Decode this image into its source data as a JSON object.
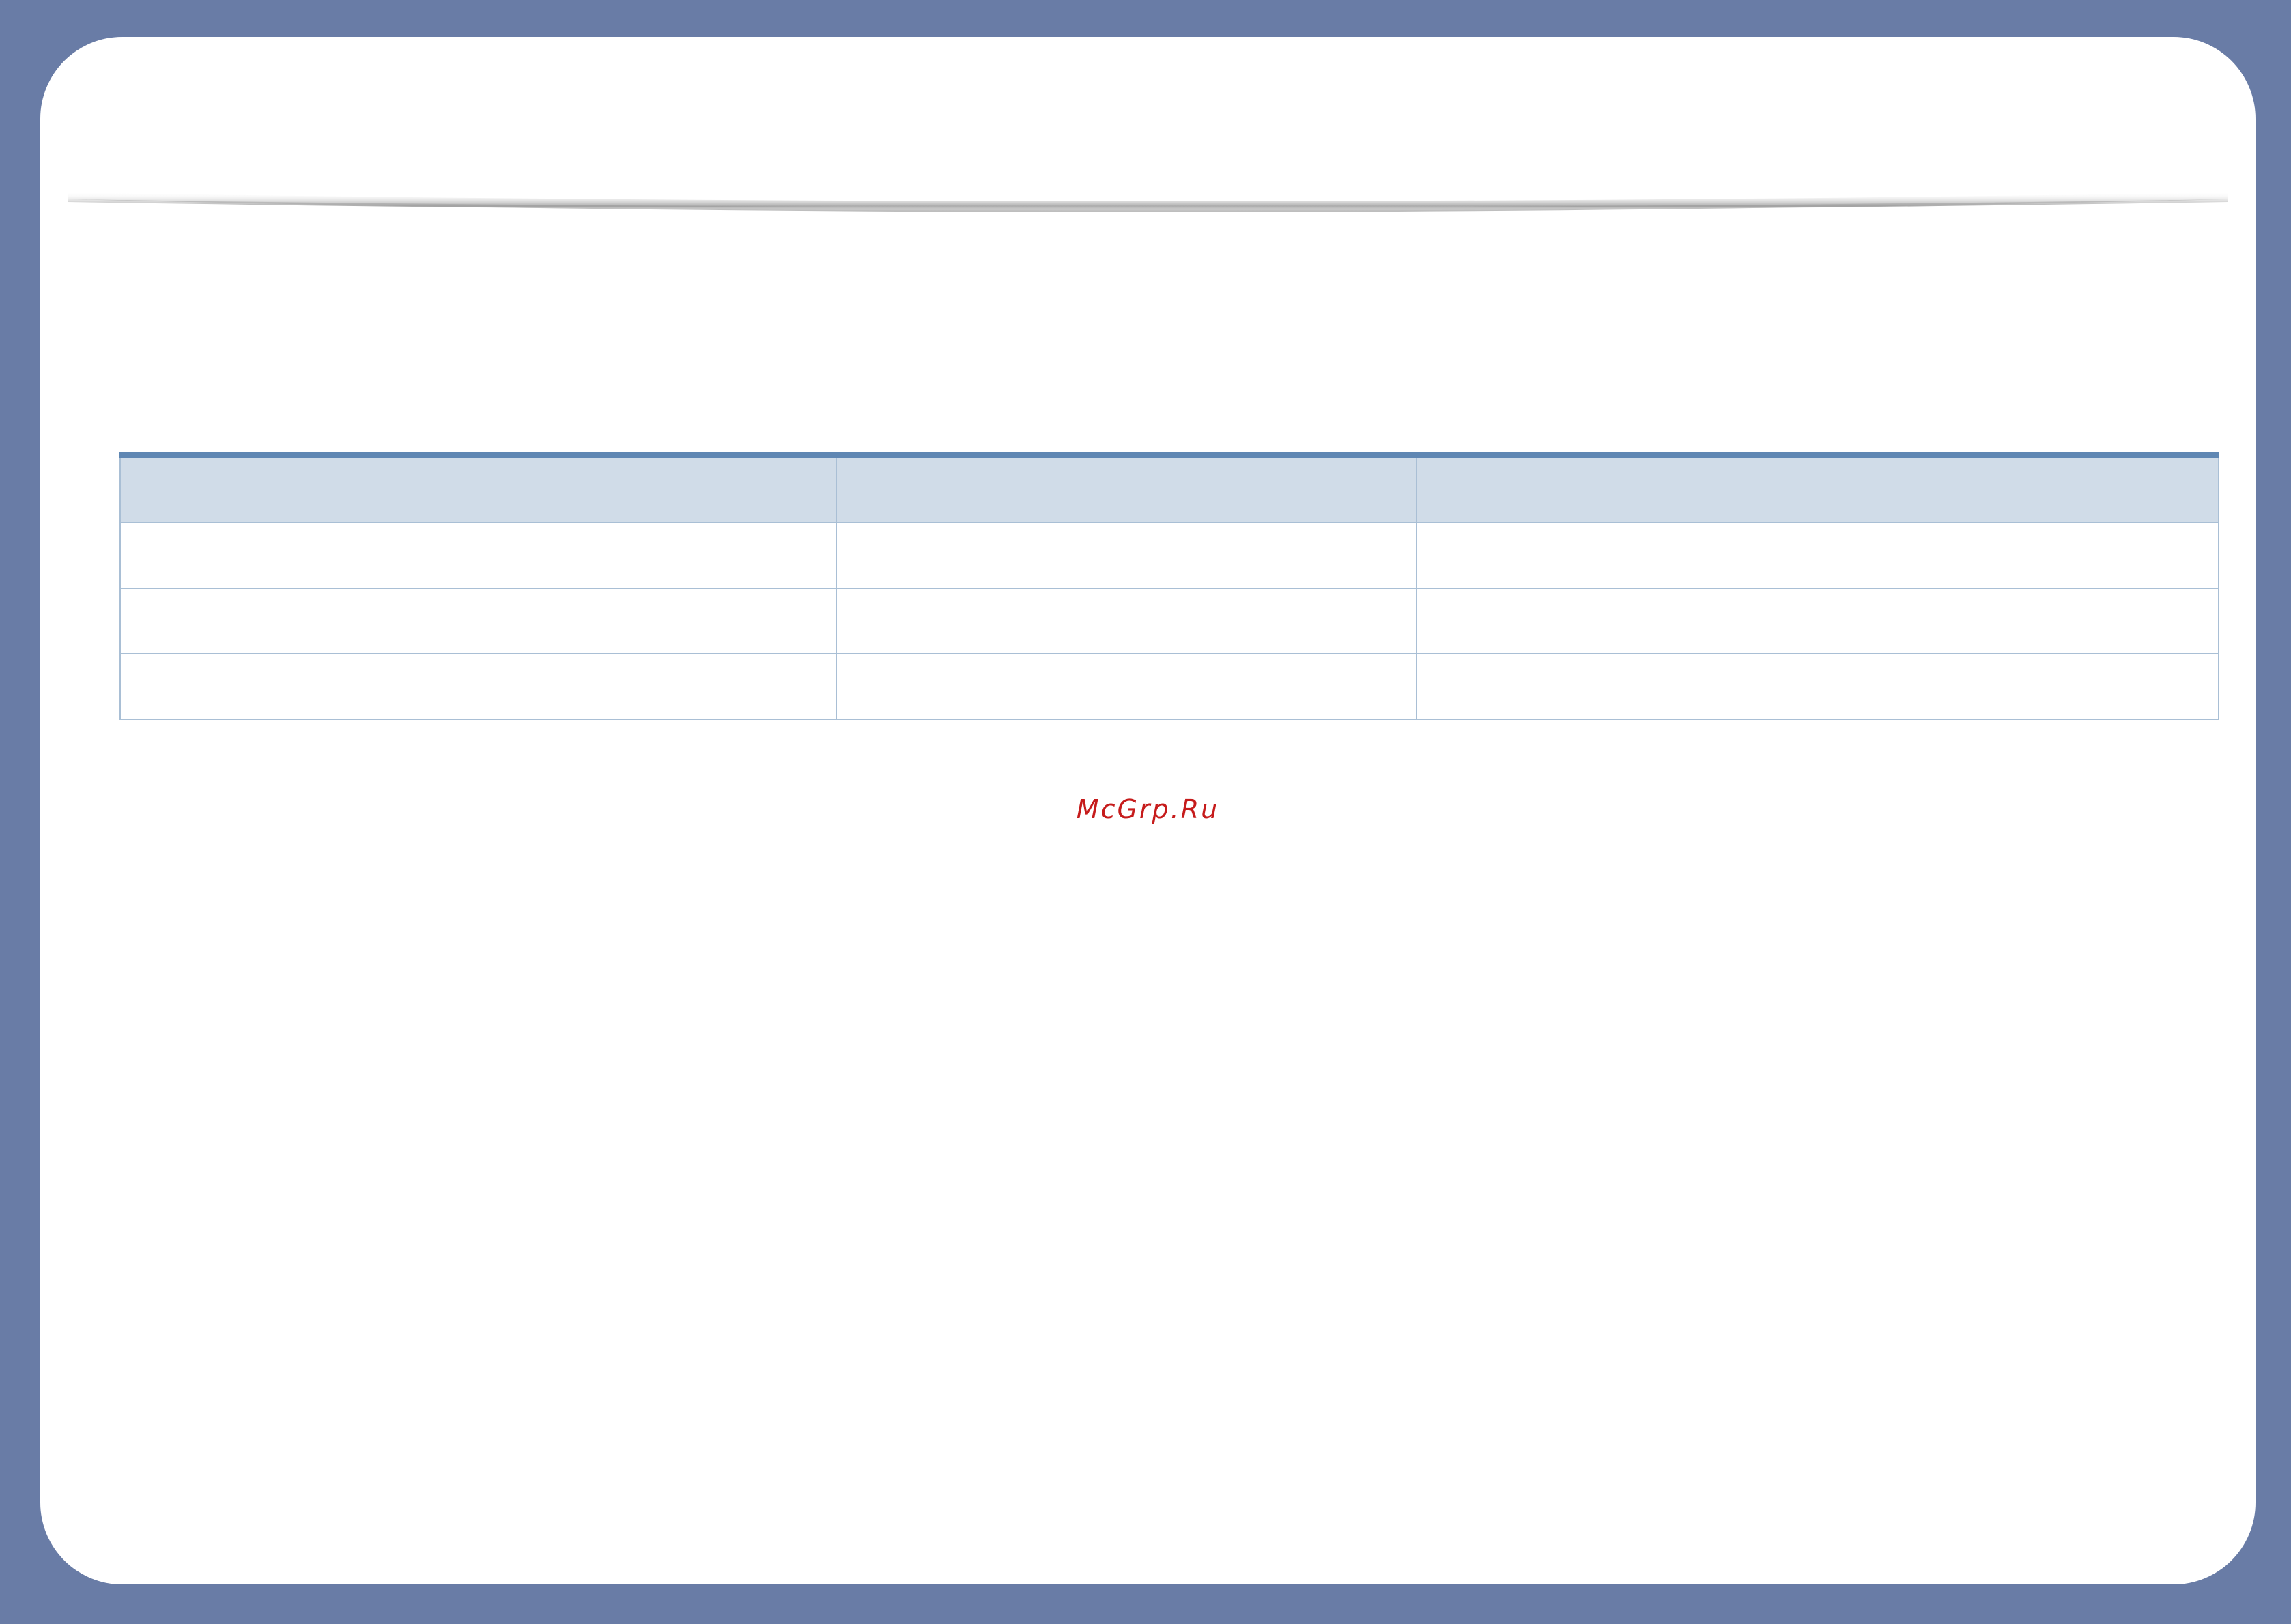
{
  "table": {
    "headers": [
      "",
      "",
      ""
    ],
    "rows": [
      [
        "",
        "",
        ""
      ],
      [
        "",
        "",
        ""
      ],
      [
        "",
        "",
        ""
      ]
    ]
  },
  "watermark": {
    "text": "McGrp.Ru",
    "color": "#c61b1b"
  },
  "colors": {
    "background": "#697ca6",
    "page": "#ffffff",
    "table_header_fill": "#d0dce8",
    "table_border": "#a9bfd5",
    "table_top_rule": "#5f87b3"
  }
}
